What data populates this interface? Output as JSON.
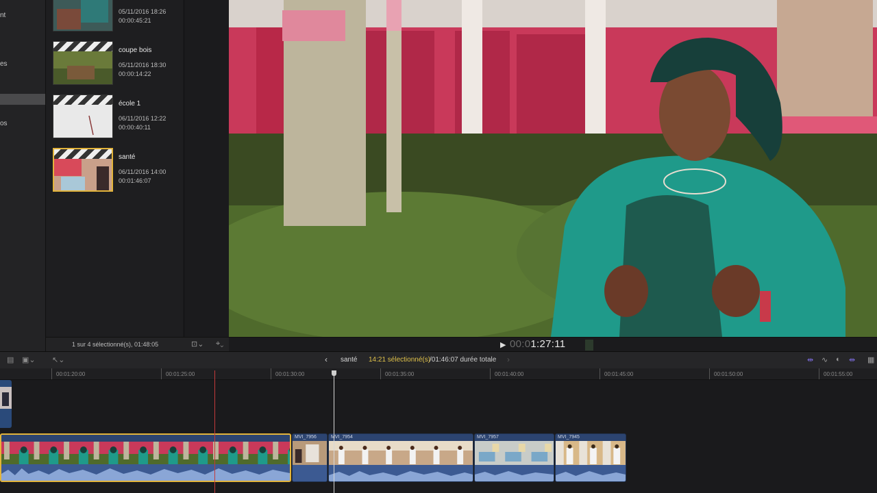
{
  "sidebar": {
    "items": [
      {
        "label": "nt"
      },
      {
        "label": "es"
      },
      {
        "label": ""
      },
      {
        "label": "os"
      }
    ]
  },
  "browser": {
    "clips": [
      {
        "name": "",
        "date": "05/11/2016 18:26",
        "duration": "00:00:45:21"
      },
      {
        "name": "coupe bois",
        "date": "05/11/2016 18:30",
        "duration": "00:00:14:22"
      },
      {
        "name": "école 1",
        "date": "06/11/2016 12:22",
        "duration": "00:00:40:11"
      },
      {
        "name": "santé",
        "date": "06/11/2016 14:00",
        "duration": "00:01:46:07"
      }
    ],
    "footer": {
      "selection_count": "1 sur 4 sélectionné(s), 01:48:05"
    }
  },
  "viewer": {
    "timecode_dim": "00:0",
    "timecode": "1:27:11"
  },
  "timeline_toolbar": {
    "project_name": "santé",
    "selection_info": "14:21 sélectionné(s)",
    "total_info": "/01:46:07 durée totale"
  },
  "ruler": {
    "ticks": [
      "00:01:20:00",
      "00:01:25:00",
      "00:01:30:00",
      "00:01:35:00",
      "00:01:40:00",
      "00:01:45:00",
      "00:01:50:00",
      "00:01:55:00"
    ]
  },
  "timeline": {
    "clips": [
      {
        "label": ""
      },
      {
        "label": "MVI_7956"
      },
      {
        "label": "MVI_7954"
      },
      {
        "label": "MVI_7957"
      },
      {
        "label": "MVI_7945"
      }
    ]
  },
  "colors": {
    "accent_yellow": "#e3b43b",
    "clip_blue": "#2c4470",
    "audio_blue": "#3c5a92",
    "skimmer_red": "#c43a3a"
  }
}
